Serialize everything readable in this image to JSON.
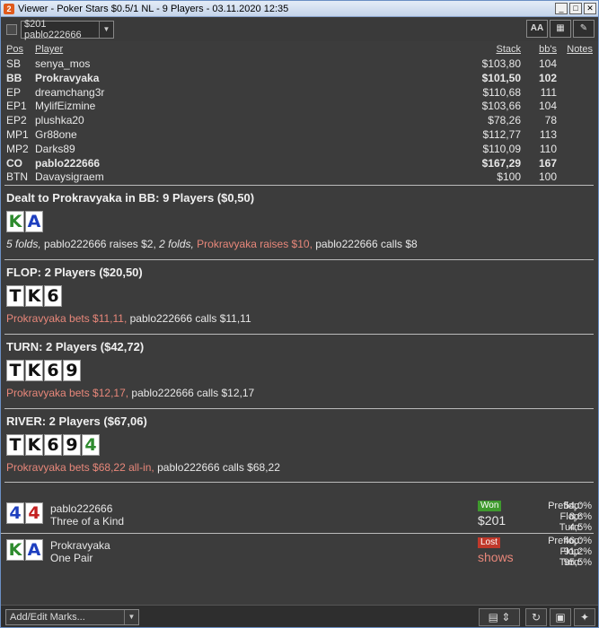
{
  "window": {
    "title": "Viewer - Poker Stars $0.5/1 NL - 9 Players - 03.11.2020 12:35",
    "app_icon": "pokertracker-icon",
    "controls": [
      "_",
      "□",
      "✕"
    ]
  },
  "toolbar": {
    "hand_select_value": "$201 pablo222666",
    "font_button_label": "AA",
    "grid_button_label": "▦",
    "edit_button_label": "✎"
  },
  "players_table": {
    "headers": {
      "pos": "Pos",
      "player": "Player",
      "stack": "Stack",
      "bbs": "bb's",
      "notes": "Notes"
    },
    "rows": [
      {
        "pos": "SB",
        "player": "senya_mos",
        "stack": "$103,80",
        "bbs": "104",
        "bold": false
      },
      {
        "pos": "BB",
        "player": "Prokravyaka",
        "stack": "$101,50",
        "bbs": "102",
        "bold": true
      },
      {
        "pos": "EP",
        "player": "dreamchang3r",
        "stack": "$110,68",
        "bbs": "111",
        "bold": false
      },
      {
        "pos": "EP1",
        "player": "MylifEizmine",
        "stack": "$103,66",
        "bbs": "104",
        "bold": false
      },
      {
        "pos": "EP2",
        "player": "plushka20",
        "stack": "$78,26",
        "bbs": "78",
        "bold": false
      },
      {
        "pos": "MP1",
        "player": "Gr88one",
        "stack": "$112,77",
        "bbs": "113",
        "bold": false
      },
      {
        "pos": "MP2",
        "player": "Darks89",
        "stack": "$110,09",
        "bbs": "110",
        "bold": false
      },
      {
        "pos": "CO",
        "player": "pablo222666",
        "stack": "$167,29",
        "bbs": "167",
        "bold": true
      },
      {
        "pos": "BTN",
        "player": "Davaysigraem",
        "stack": "$100",
        "bbs": "100",
        "bold": false
      }
    ]
  },
  "preflop": {
    "header": "Dealt to Prokravyaka in BB: 9 Players ($0,50)",
    "cards": [
      {
        "rank": "K",
        "color": "green"
      },
      {
        "rank": "A",
        "color": "blue"
      }
    ],
    "action_folds1": "5 folds,",
    "action_pablo_raise": " pablo222666 raises $2,",
    "action_folds2": " 2 folds,",
    "action_hero_raise": " Prokravyaka raises $10,",
    "action_pablo_call": " pablo222666 calls $8"
  },
  "flop": {
    "header": "FLOP: 2 Players ($20,50)",
    "cards": [
      {
        "rank": "T",
        "color": "black"
      },
      {
        "rank": "K",
        "color": "black"
      },
      {
        "rank": "6",
        "color": "black"
      }
    ],
    "action_hero": "Prokravyaka bets $11,11,",
    "action_villain": " pablo222666 calls $11,11"
  },
  "turn": {
    "header": "TURN: 2 Players ($42,72)",
    "cards": [
      {
        "rank": "T",
        "color": "black"
      },
      {
        "rank": "K",
        "color": "black"
      },
      {
        "rank": "6",
        "color": "black"
      },
      {
        "rank": "9",
        "color": "black"
      }
    ],
    "action_hero": "Prokravyaka bets $12,17,",
    "action_villain": " pablo222666 calls $12,17"
  },
  "river": {
    "header": "RIVER: 2 Players ($67,06)",
    "cards": [
      {
        "rank": "T",
        "color": "black"
      },
      {
        "rank": "K",
        "color": "black"
      },
      {
        "rank": "6",
        "color": "black"
      },
      {
        "rank": "9",
        "color": "black"
      },
      {
        "rank": "4",
        "color": "green"
      }
    ],
    "action_hero": "Prokravyaka bets $68,22 all-in,",
    "action_villain": " pablo222666 calls $68,22"
  },
  "results": [
    {
      "player": "pablo222666",
      "hand": "Three of a Kind",
      "cards": [
        {
          "rank": "4",
          "color": "blue"
        },
        {
          "rank": "4",
          "color": "red"
        }
      ],
      "badge": "Won",
      "amount": "$201",
      "equity": [
        {
          "label": "Preflop:",
          "value": "54,0%"
        },
        {
          "label": "Flop:",
          "value": "8,8%"
        },
        {
          "label": "Turn:",
          "value": "4,5%"
        }
      ]
    },
    {
      "player": "Prokravyaka",
      "hand": "One Pair",
      "cards": [
        {
          "rank": "K",
          "color": "green"
        },
        {
          "rank": "A",
          "color": "blue"
        }
      ],
      "badge": "Lost",
      "amount": "shows",
      "equity": [
        {
          "label": "Preflop:",
          "value": "46,0%"
        },
        {
          "label": "Flop:",
          "value": "91,2%"
        },
        {
          "label": "Turn:",
          "value": "95,5%"
        }
      ]
    }
  ],
  "statusbar": {
    "marks_label": "Add/Edit Marks...",
    "calc_icon": "calculator-icon",
    "updown_icon": "up-down-icon",
    "refresh_icon": "refresh-icon",
    "save_icon": "save-icon",
    "twitter_icon": "twitter-icon"
  }
}
